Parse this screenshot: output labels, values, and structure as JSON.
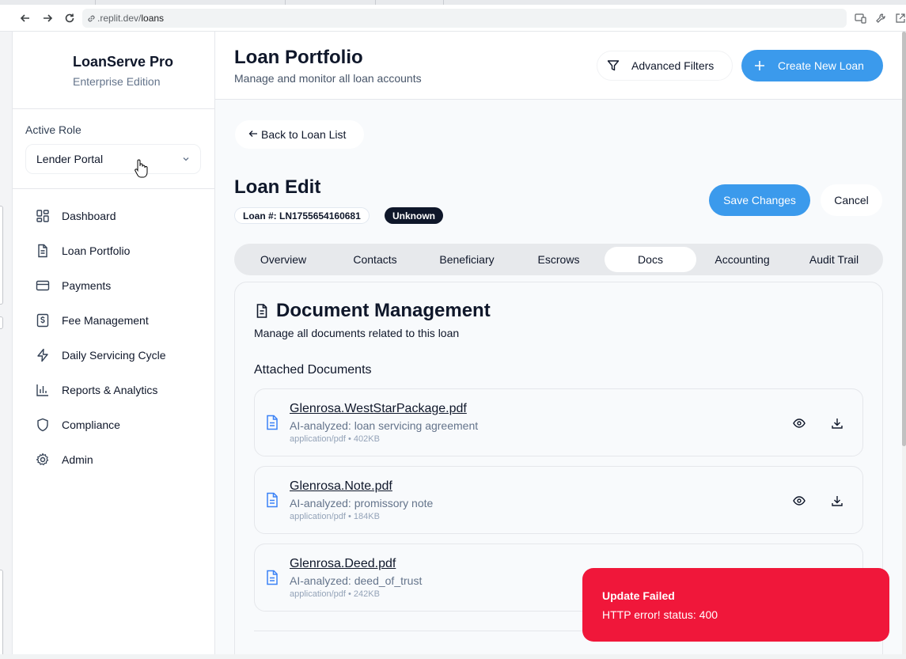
{
  "browser": {
    "url_prefix": ".replit.dev/",
    "url_path": "loans"
  },
  "sidebar": {
    "brand_name": "LoanServe Pro",
    "brand_edition": "Enterprise Edition",
    "role_label": "Active Role",
    "role_value": "Lender Portal",
    "items": [
      {
        "label": "Dashboard",
        "icon": "dashboard-icon"
      },
      {
        "label": "Loan Portfolio",
        "icon": "document-icon"
      },
      {
        "label": "Payments",
        "icon": "credit-card-icon"
      },
      {
        "label": "Fee Management",
        "icon": "dollar-receipt-icon"
      },
      {
        "label": "Daily Servicing Cycle",
        "icon": "lightning-icon"
      },
      {
        "label": "Reports & Analytics",
        "icon": "bar-chart-icon"
      },
      {
        "label": "Compliance",
        "icon": "shield-icon"
      },
      {
        "label": "Admin",
        "icon": "gear-icon"
      }
    ]
  },
  "header": {
    "title": "Loan Portfolio",
    "subtitle": "Manage and monitor all loan accounts",
    "filters_label": "Advanced Filters",
    "create_label": "Create New Loan"
  },
  "main": {
    "back_label": "Back to Loan List",
    "edit_title": "Loan Edit",
    "loan_number": "Loan #: LN1755654160681",
    "status": "Unknown",
    "save_label": "Save Changes",
    "cancel_label": "Cancel",
    "tabs": [
      "Overview",
      "Contacts",
      "Beneficiary",
      "Escrows",
      "Docs",
      "Accounting",
      "Audit Trail"
    ],
    "active_tab": "Docs"
  },
  "documents": {
    "title": "Document Management",
    "subtitle": "Manage all documents related to this loan",
    "section_label": "Attached Documents",
    "items": [
      {
        "name": "Glenrosa.WestStarPackage.pdf",
        "description": "AI-analyzed: loan servicing agreement",
        "meta": "application/pdf • 402KB"
      },
      {
        "name": "Glenrosa.Note.pdf",
        "description": "AI-analyzed: promissory note",
        "meta": "application/pdf • 184KB"
      },
      {
        "name": "Glenrosa.Deed.pdf",
        "description": "AI-analyzed: deed_of_trust",
        "meta": "application/pdf • 242KB"
      }
    ]
  },
  "toast": {
    "title": "Update Failed",
    "message": "HTTP error! status: 400",
    "color": "#f0173a"
  },
  "colors": {
    "accent": "#3b9aec",
    "badge_dark": "#0f172a",
    "doc_icon": "#3b82f6"
  }
}
